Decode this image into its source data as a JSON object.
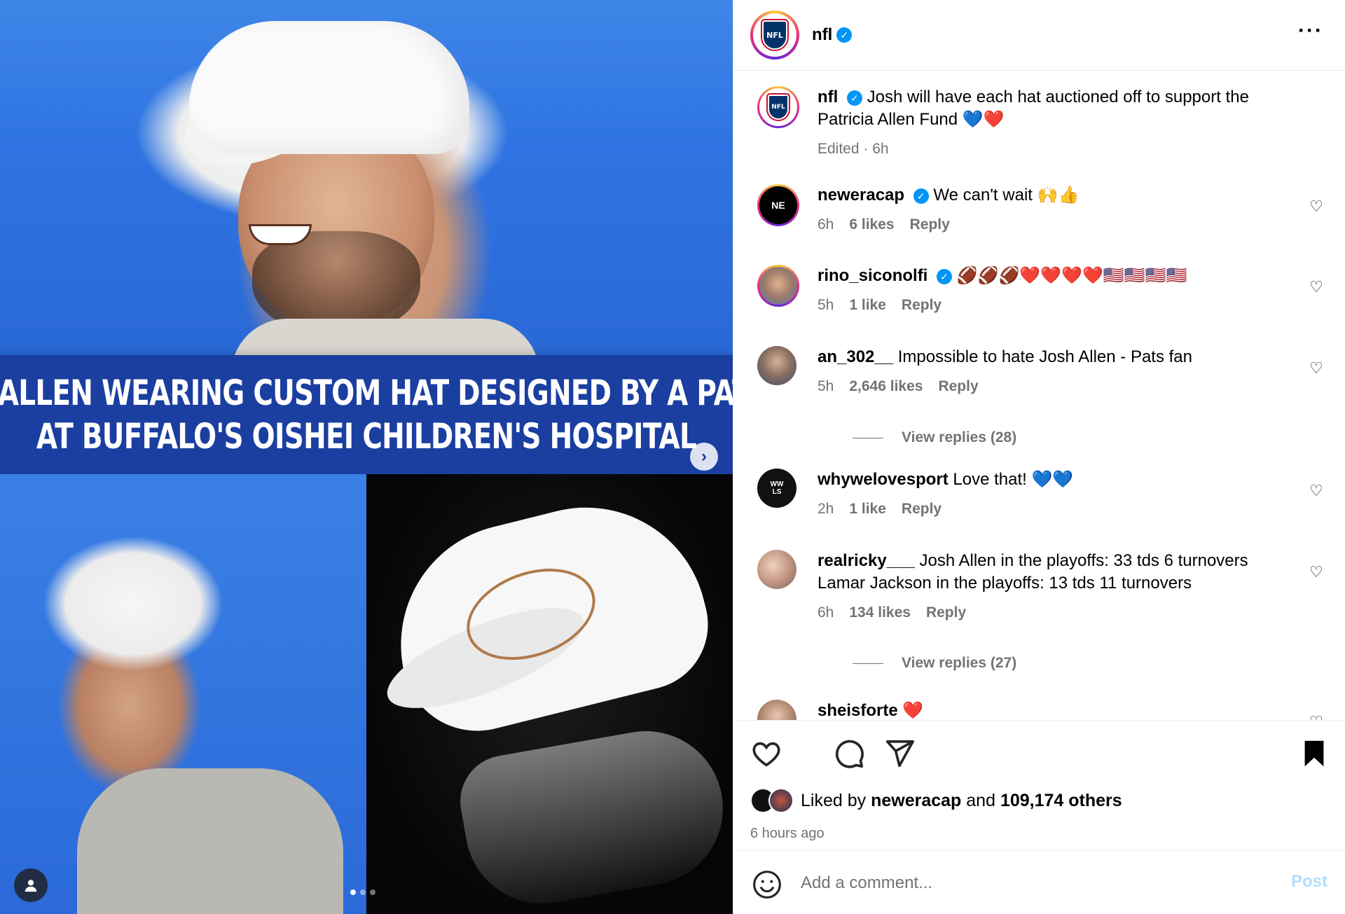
{
  "media": {
    "banner_line_1": "JOSH ALLEN WEARING CUSTOM HAT DESIGNED BY A PATIENT",
    "banner_line_2": "AT BUFFALO'S OISHEI CHILDREN'S HOSPITAL",
    "next_icon": "chevron-right-icon",
    "carousel": {
      "total": 3,
      "active_index": 0
    }
  },
  "header": {
    "username": "nfl",
    "verified": true,
    "more_icon": "more-horizontal-icon",
    "avatar_text": "NFL"
  },
  "caption": {
    "username": "nfl",
    "text": "Josh will have each hat auctioned off to support the Patricia Allen Fund 💙❤️",
    "edited": "Edited · 6h"
  },
  "comments": [
    {
      "username": "neweracap",
      "verified": true,
      "text": "We can't wait 🙌👍",
      "time": "6h",
      "likes": "6 likes",
      "reply": "Reply"
    },
    {
      "username": "rino_siconolfi",
      "verified": true,
      "text": "🏈🏈🏈❤️❤️❤️❤️🇺🇸🇺🇸🇺🇸🇺🇸",
      "time": "5h",
      "likes": "1 like",
      "reply": "Reply"
    },
    {
      "username": "an_302__",
      "verified": false,
      "text": "Impossible to hate Josh Allen - Pats fan",
      "time": "5h",
      "likes": "2,646 likes",
      "reply": "Reply",
      "view_replies": "View replies (28)"
    },
    {
      "username": "whywelovesport",
      "verified": false,
      "text": "Love that! 💙💙",
      "time": "2h",
      "likes": "1 like",
      "reply": "Reply",
      "avatar_text": "WW LS"
    },
    {
      "username": "realricky___",
      "verified": false,
      "text": "Josh Allen in the playoffs: 33 tds 6 turnovers Lamar Jackson in the playoffs: 13 tds 11 turnovers",
      "time": "6h",
      "likes": "134 likes",
      "reply": "Reply",
      "view_replies": "View replies (27)"
    },
    {
      "username": "sheisforte",
      "verified": false,
      "text": "❤️"
    }
  ],
  "actions": {
    "like_icon": "heart-icon",
    "comment_icon": "comment-icon",
    "share_icon": "send-icon",
    "save_icon": "bookmark-icon",
    "liked_by_prefix": "Liked by",
    "liked_by_user": "neweracap",
    "liked_by_and": "and",
    "liked_by_count": "109,174 others",
    "timestamp": "6 hours ago"
  },
  "add_comment": {
    "emoji_icon": "emoji-icon",
    "placeholder": "Add a comment...",
    "post_label": "Post"
  },
  "colors": {
    "banner": "#1b3fa0",
    "verified": "#0095f6",
    "post_disabled": "#b2dffc",
    "meta_gray": "#737373"
  }
}
